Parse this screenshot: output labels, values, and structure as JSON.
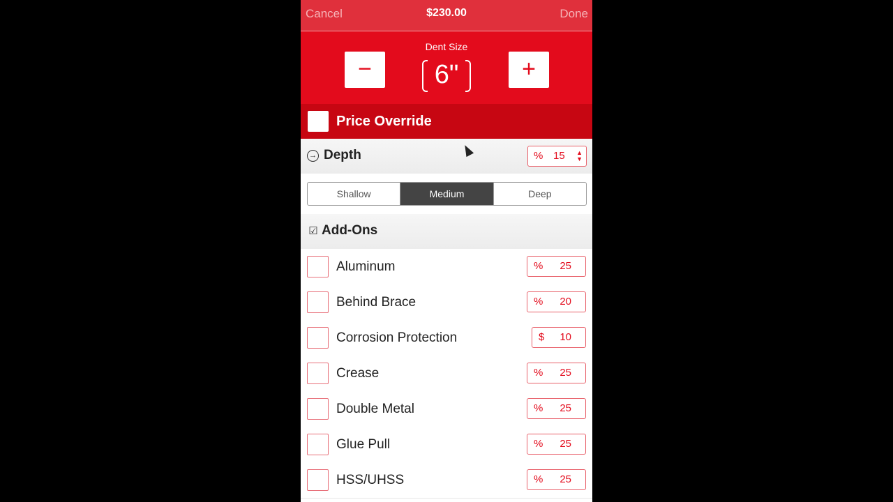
{
  "navbar": {
    "cancel_label": "Cancel",
    "title": "$230.00",
    "done_label": "Done"
  },
  "dent": {
    "label": "Dent Size",
    "minus_label": "−",
    "plus_label": "+",
    "value": "6\""
  },
  "override": {
    "label": "Price Override",
    "checked": false
  },
  "depth": {
    "title": "Depth",
    "icon": "circle-arrow-icon",
    "unit": "%",
    "value": "15",
    "segments": [
      "Shallow",
      "Medium",
      "Deep"
    ],
    "selected": "Medium"
  },
  "addons": {
    "title": "Add-Ons",
    "icon": "checkbox-icon",
    "items": [
      {
        "label": "Aluminum",
        "unit": "%",
        "value": "25",
        "checked": false
      },
      {
        "label": "Behind Brace",
        "unit": "%",
        "value": "20",
        "checked": false
      },
      {
        "label": "Corrosion Protection",
        "unit": "$",
        "value": "10",
        "checked": false
      },
      {
        "label": "Crease",
        "unit": "%",
        "value": "25",
        "checked": false
      },
      {
        "label": "Double Metal",
        "unit": "%",
        "value": "25",
        "checked": false
      },
      {
        "label": "Glue Pull",
        "unit": "%",
        "value": "25",
        "checked": false
      },
      {
        "label": "HSS/UHSS",
        "unit": "%",
        "value": "25",
        "checked": false
      }
    ]
  },
  "colors": {
    "accent": "#e30b1c",
    "navbar": "#e0303c",
    "override_bg": "#c70612"
  }
}
